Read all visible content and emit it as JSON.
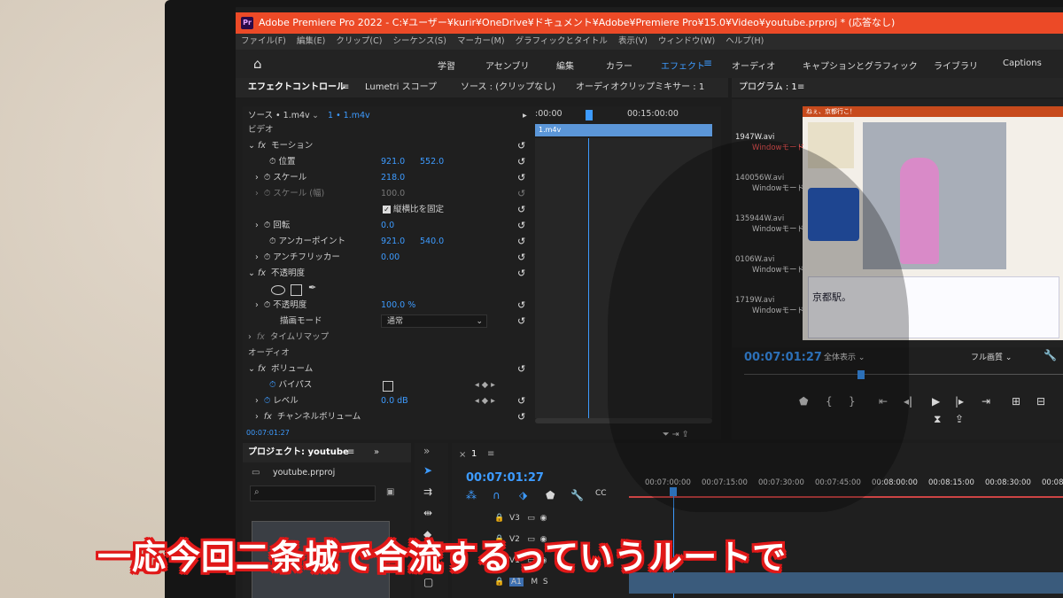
{
  "window": {
    "title": "Adobe Premiere Pro 2022 - C:¥ユーザー¥kurir¥OneDrive¥ドキュメント¥Adobe¥Premiere Pro¥15.0¥Video¥youtube.prproj * (応答なし)"
  },
  "menu": [
    "ファイル(F)",
    "編集(E)",
    "クリップ(C)",
    "シーケンス(S)",
    "マーカー(M)",
    "グラフィックとタイトル",
    "表示(V)",
    "ウィンドウ(W)",
    "ヘルプ(H)"
  ],
  "workspaces": [
    "学習",
    "アセンブリ",
    "編集",
    "カラー",
    "エフェクト",
    "オーディオ",
    "キャプションとグラフィック",
    "ライブラリ",
    "Captions"
  ],
  "active_workspace": "エフェクト",
  "effect_controls": {
    "tabs": [
      "エフェクトコントロール",
      "Lumetri スコープ",
      "ソース : (クリップなし)",
      "オーディオクリップミキサー : 1"
    ],
    "source": "ソース • 1.m4v",
    "clip_select": "1 • 1.m4v",
    "time_start": ":00:00",
    "time_mid": "00:15:00:00",
    "clip_label": "1.m4v",
    "video_section": "ビデオ",
    "motion": "モーション",
    "position_label": "位置",
    "position_x": "921.0",
    "position_y": "552.0",
    "scale_label": "スケール",
    "scale_value": "218.0",
    "scale_w_label": "スケール (幅)",
    "scale_w_value": "100.0",
    "uniform_scale": "縦横比を固定",
    "rotation_label": "回転",
    "rotation_value": "0.0",
    "anchor_label": "アンカーポイント",
    "anchor_x": "921.0",
    "anchor_y": "540.0",
    "flicker_label": "アンチフリッカー",
    "flicker_value": "0.00",
    "opacity_section": "不透明度",
    "opacity_label": "不透明度",
    "opacity_value": "100.0 %",
    "blend_label": "描画モード",
    "blend_value": "通常",
    "timeremap": "タイムリマップ",
    "audio_section": "オーディオ",
    "volume": "ボリューム",
    "bypass": "バイパス",
    "level_label": "レベル",
    "level_value": "0.0 dB",
    "channel_volume": "チャンネルボリューム",
    "timecode": "00:07:01:27"
  },
  "program": {
    "title": "プログラム : 1",
    "timecode": "00:07:01:27",
    "zoom": "全体表示",
    "quality": "フル画質",
    "files": [
      "1947W.avi",
      "140056W.avi",
      "135944W.avi",
      "0106W.avi",
      "1719W.avi"
    ],
    "file_modes": [
      "Windowモード",
      "Windowモード",
      "Windowモード",
      "Windowモード",
      "Windowモード"
    ],
    "game_title": "ねぇ、京都行こ！",
    "game_text": "京都駅。"
  },
  "project": {
    "title": "プロジェクト: youtube",
    "file": "youtube.prproj"
  },
  "timeline": {
    "tab": "1",
    "timecode": "00:07:01:27",
    "ruler": [
      "00:07:00:00",
      "00:07:15:00",
      "00:07:30:00",
      "00:07:45:00",
      "00:08:00:00",
      "00:08:15:00",
      "00:08:30:00",
      "00:08"
    ],
    "tracks": [
      "V3",
      "V2",
      "V1",
      "A1"
    ]
  },
  "subtitle": "一応今回二条城で合流するっていうルートで"
}
